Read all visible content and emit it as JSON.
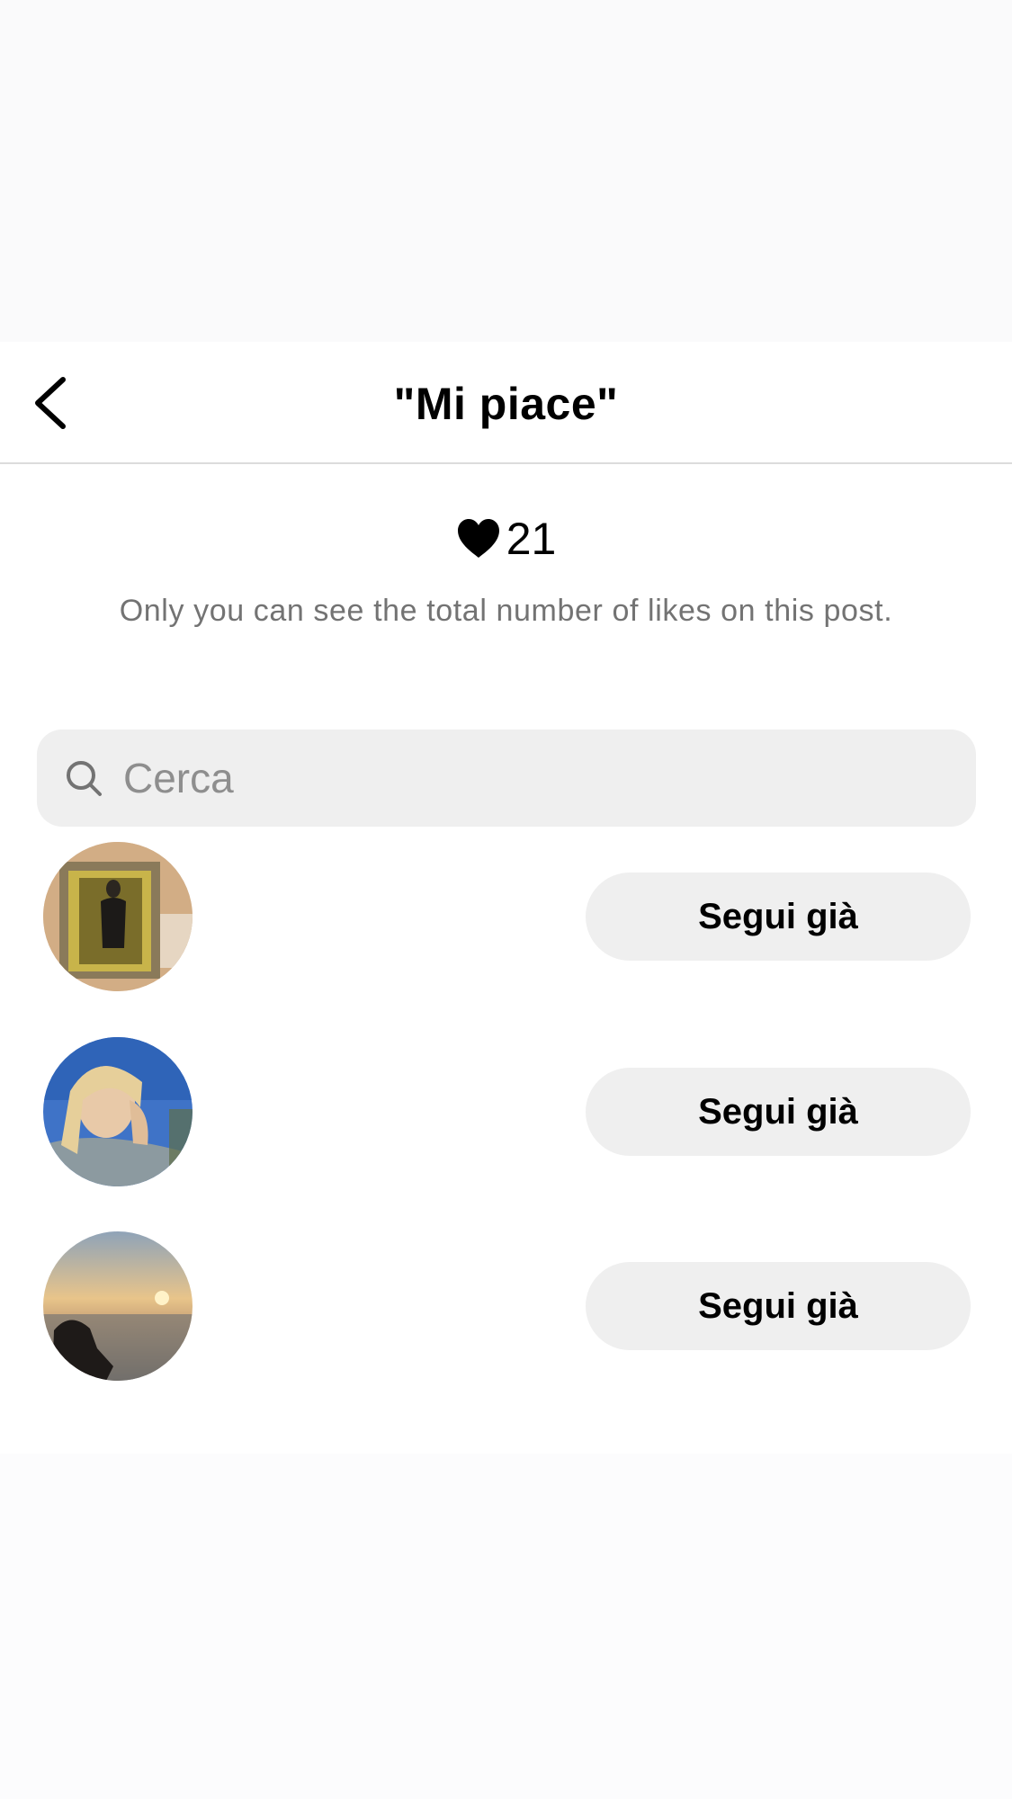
{
  "header": {
    "title": "\"Mi piace\"",
    "back_icon": "chevron-left-icon"
  },
  "likes": {
    "icon": "heart-icon",
    "count": "21",
    "note": "Only you can see the total number of likes on this post."
  },
  "search": {
    "icon": "search-icon",
    "placeholder": "Cerca",
    "value": ""
  },
  "users": [
    {
      "username": "",
      "button_label": "Segui già"
    },
    {
      "username": "",
      "button_label": "Segui già"
    },
    {
      "username": "",
      "button_label": "Segui già"
    }
  ],
  "colors": {
    "background": "#ffffff",
    "muted_text": "#737373",
    "button_bg": "#efefef",
    "divider": "#dcdcdc"
  }
}
